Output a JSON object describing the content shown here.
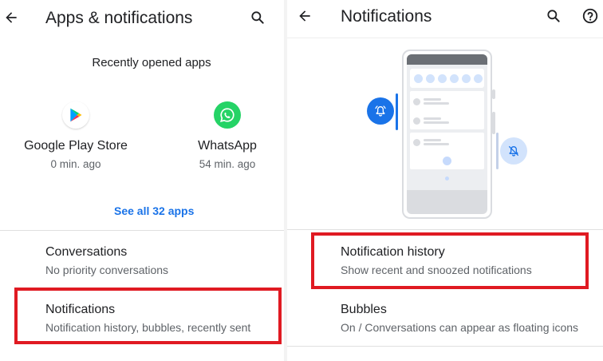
{
  "left_panel": {
    "appbar": {
      "title": "Apps & notifications",
      "back_icon": "arrow-back-icon",
      "search_icon": "search-icon"
    },
    "recent": {
      "label": "Recently opened apps",
      "apps": [
        {
          "name": "Google Play Store",
          "time": "0 min. ago",
          "icon": "google-play-icon"
        },
        {
          "name": "WhatsApp",
          "time": "54 min. ago",
          "icon": "whatsapp-icon"
        }
      ],
      "see_all": "See all 32 apps"
    },
    "items": [
      {
        "title": "Conversations",
        "subtitle": "No priority conversations"
      },
      {
        "title": "Notifications",
        "subtitle": "Notification history, bubbles, recently sent"
      }
    ]
  },
  "right_panel": {
    "appbar": {
      "title": "Notifications",
      "back_icon": "arrow-back-icon",
      "search_icon": "search-icon",
      "help_icon": "help-icon"
    },
    "illustration": "notification-shade-illustration",
    "items": [
      {
        "title": "Notification history",
        "subtitle": "Show recent and snoozed notifications"
      },
      {
        "title": "Bubbles",
        "subtitle": "On / Conversations can appear as floating icons"
      }
    ]
  },
  "colors": {
    "accent": "#1a73e8",
    "highlight": "#e01a22",
    "whatsapp": "#25d366",
    "text_primary": "#202124",
    "text_secondary": "#5f6368",
    "divider": "#e0e0e0"
  }
}
